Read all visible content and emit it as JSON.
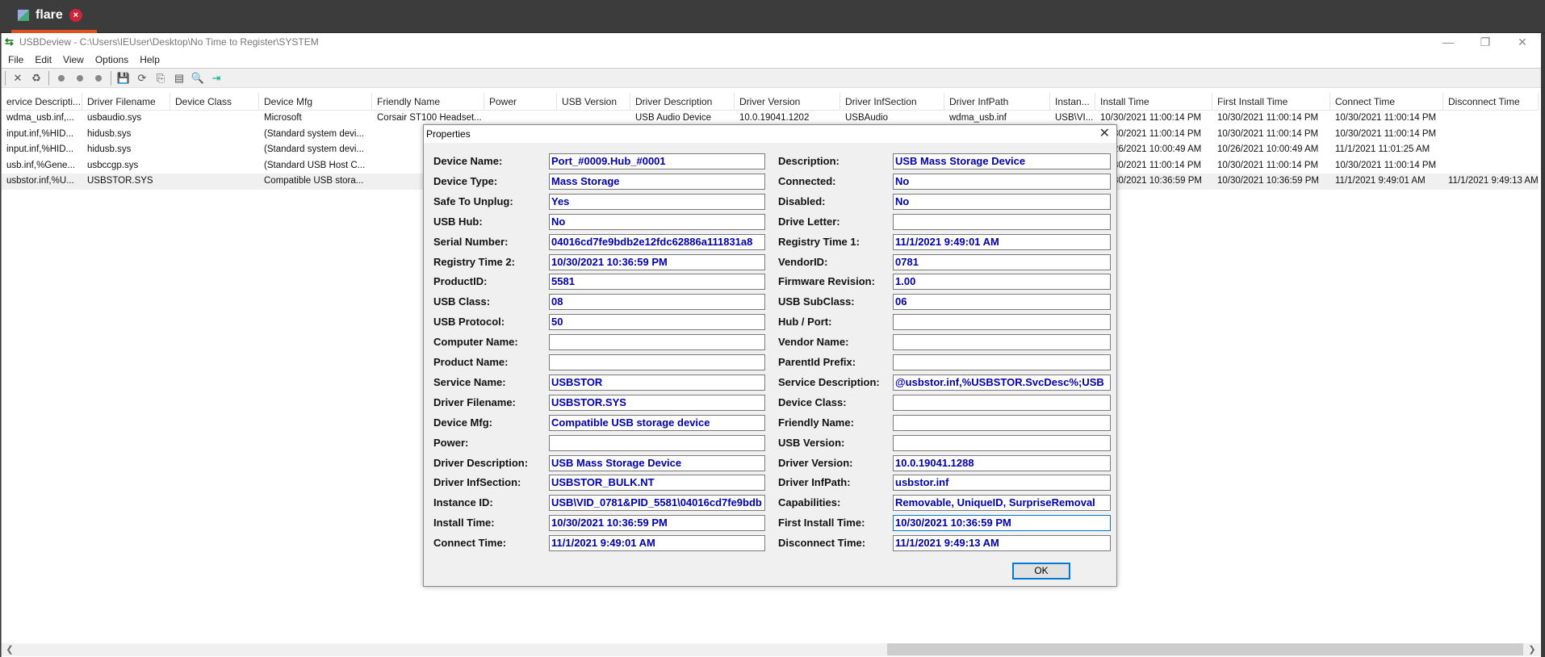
{
  "tab": {
    "title": "flare",
    "close": "×"
  },
  "window": {
    "title": "USBDeview - C:\\Users\\IEUser\\Desktop\\No Time to Register\\SYSTEM",
    "minimize": "—",
    "maximize": "❐",
    "close": "✕"
  },
  "menu": [
    "File",
    "Edit",
    "View",
    "Options",
    "Help"
  ],
  "list": {
    "columns": [
      "ervice Descripti...",
      "Driver Filename",
      "Device Class",
      "Device Mfg",
      "Friendly Name",
      "Power",
      "USB Version",
      "Driver Description",
      "Driver Version",
      "Driver InfSection",
      "Driver InfPath",
      "Instan...",
      "Install Time",
      "First Install Time",
      "Connect Time",
      "Disconnect Time"
    ],
    "rows": [
      [
        "wdma_usb.inf,...",
        "usbaudio.sys",
        "",
        "Microsoft",
        "Corsair ST100 Headset...",
        "",
        "",
        "USB Audio Device",
        "10.0.19041.1202",
        "USBAudio",
        "wdma_usb.inf",
        "USB\\VI...",
        "10/30/2021 11:00:14 PM",
        "10/30/2021 11:00:14 PM",
        "10/30/2021 11:00:14 PM",
        ""
      ],
      [
        "input.inf,%HID...",
        "hidusb.sys",
        "",
        "(Standard system devi...",
        "",
        "",
        "",
        "",
        "",
        "",
        "",
        "",
        "10/30/2021 11:00:14 PM",
        "10/30/2021 11:00:14 PM",
        "10/30/2021 11:00:14 PM",
        ""
      ],
      [
        "input.inf,%HID...",
        "hidusb.sys",
        "",
        "(Standard system devi...",
        "",
        "",
        "",
        "",
        "",
        "",
        "",
        "",
        "10/26/2021 10:00:49 AM",
        "10/26/2021 10:00:49 AM",
        "11/1/2021 11:01:25 AM",
        ""
      ],
      [
        "usb.inf,%Gene...",
        "usbccgp.sys",
        "",
        "(Standard USB Host C...",
        "",
        "",
        "",
        "",
        "",
        "",
        "",
        "",
        "10/30/2021 11:00:14 PM",
        "10/30/2021 11:00:14 PM",
        "10/30/2021 11:00:14 PM",
        ""
      ],
      [
        "usbstor.inf,%U...",
        "USBSTOR.SYS",
        "",
        "Compatible USB stora...",
        "",
        "",
        "",
        "",
        "",
        "",
        "",
        "",
        "10/30/2021 10:36:59 PM",
        "10/30/2021 10:36:59 PM",
        "11/1/2021 9:49:01 AM",
        "11/1/2021 9:49:13 AM"
      ]
    ]
  },
  "dialog": {
    "title": "Properties",
    "close": "✕",
    "ok_label": "OK",
    "fields": [
      [
        {
          "label": "Device Name:",
          "value": "Port_#0009.Hub_#0001"
        },
        {
          "label": "Description:",
          "value": "USB Mass Storage Device"
        }
      ],
      [
        {
          "label": "Device Type:",
          "value": "Mass Storage"
        },
        {
          "label": "Connected:",
          "value": "No"
        }
      ],
      [
        {
          "label": "Safe To Unplug:",
          "value": "Yes"
        },
        {
          "label": "Disabled:",
          "value": "No"
        }
      ],
      [
        {
          "label": "USB Hub:",
          "value": "No"
        },
        {
          "label": "Drive Letter:",
          "value": ""
        }
      ],
      [
        {
          "label": "Serial Number:",
          "value": "04016cd7fe9bdb2e12fdc62886a111831a8"
        },
        {
          "label": "Registry Time 1:",
          "value": "11/1/2021 9:49:01 AM"
        }
      ],
      [
        {
          "label": "Registry Time 2:",
          "value": "10/30/2021 10:36:59 PM"
        },
        {
          "label": "VendorID:",
          "value": "0781"
        }
      ],
      [
        {
          "label": "ProductID:",
          "value": "5581"
        },
        {
          "label": "Firmware Revision:",
          "value": "1.00"
        }
      ],
      [
        {
          "label": "USB Class:",
          "value": "08"
        },
        {
          "label": "USB SubClass:",
          "value": "06"
        }
      ],
      [
        {
          "label": "USB Protocol:",
          "value": "50"
        },
        {
          "label": "Hub / Port:",
          "value": ""
        }
      ],
      [
        {
          "label": "Computer Name:",
          "value": ""
        },
        {
          "label": "Vendor Name:",
          "value": ""
        }
      ],
      [
        {
          "label": "Product Name:",
          "value": ""
        },
        {
          "label": "ParentId Prefix:",
          "value": ""
        }
      ],
      [
        {
          "label": "Service Name:",
          "value": "USBSTOR"
        },
        {
          "label": "Service Description:",
          "value": "@usbstor.inf,%USBSTOR.SvcDesc%;USB"
        }
      ],
      [
        {
          "label": "Driver Filename:",
          "value": "USBSTOR.SYS"
        },
        {
          "label": "Device Class:",
          "value": ""
        }
      ],
      [
        {
          "label": "Device Mfg:",
          "value": "Compatible USB storage device"
        },
        {
          "label": "Friendly Name:",
          "value": ""
        }
      ],
      [
        {
          "label": "Power:",
          "value": ""
        },
        {
          "label": "USB Version:",
          "value": ""
        }
      ],
      [
        {
          "label": "Driver Description:",
          "value": "USB Mass Storage Device"
        },
        {
          "label": "Driver Version:",
          "value": "10.0.19041.1288"
        }
      ],
      [
        {
          "label": "Driver InfSection:",
          "value": "USBSTOR_BULK.NT"
        },
        {
          "label": "Driver InfPath:",
          "value": "usbstor.inf"
        }
      ],
      [
        {
          "label": "Instance ID:",
          "value": "USB\\VID_0781&PID_5581\\04016cd7fe9bdb"
        },
        {
          "label": "Capabilities:",
          "value": "Removable, UniqueID, SurpriseRemoval"
        }
      ],
      [
        {
          "label": "Install Time:",
          "value": "10/30/2021 10:36:59 PM"
        },
        {
          "label": "First Install Time:",
          "value": "10/30/2021 10:36:59 PM"
        }
      ],
      [
        {
          "label": "Connect Time:",
          "value": "11/1/2021 9:49:01 AM"
        },
        {
          "label": "Disconnect Time:",
          "value": "11/1/2021 9:49:13 AM"
        }
      ]
    ]
  },
  "colors": {
    "accent": "#e0501c",
    "value_text": "#0000b0",
    "focus": "#0078d7"
  }
}
